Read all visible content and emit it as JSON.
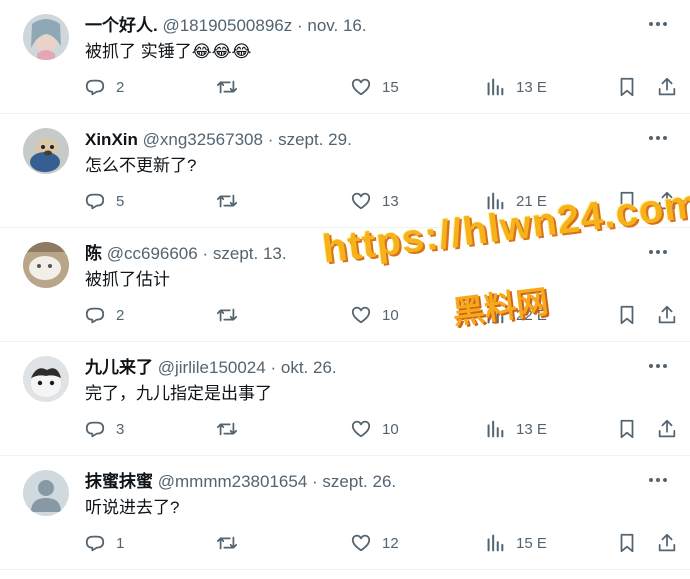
{
  "tweets": [
    {
      "name": "一个好人.",
      "handle": "@18190500896z",
      "date": "nov. 16.",
      "text": "被抓了 实锤了😂😂😂",
      "replies": "2",
      "retweets": "",
      "likes": "15",
      "views": "13 E",
      "avatar": "photo-avatar-pink"
    },
    {
      "name": "XinXin",
      "handle": "@xng32567308",
      "date": "szept. 29.",
      "text": "怎么不更新了?",
      "replies": "5",
      "retweets": "",
      "likes": "13",
      "views": "21 E",
      "avatar": "photo-avatar-dog"
    },
    {
      "name": "陈",
      "handle": "@cc696606",
      "date": "szept. 13.",
      "text": "被抓了估计",
      "replies": "2",
      "retweets": "",
      "likes": "10",
      "views": "22 E",
      "avatar": "photo-avatar-cat"
    },
    {
      "name": "九儿来了",
      "handle": "@jirlile150024",
      "date": "okt. 26.",
      "text": "完了，九儿指定是出事了",
      "replies": "3",
      "retweets": "",
      "likes": "10",
      "views": "13 E",
      "avatar": "photo-avatar-kitten"
    },
    {
      "name": "抹蜜抹蜜",
      "handle": "@mmmm23801654",
      "date": "szept. 26.",
      "text": "听说进去了?",
      "replies": "1",
      "retweets": "",
      "likes": "12",
      "views": "15 E",
      "avatar": "default-avatar"
    }
  ],
  "separator": "·",
  "watermark": {
    "url": "https://hlwn24.com",
    "label": "黑料网"
  },
  "colors": {
    "muted": "#536471",
    "text": "#0f1419",
    "watermark": "#f7b21b"
  }
}
